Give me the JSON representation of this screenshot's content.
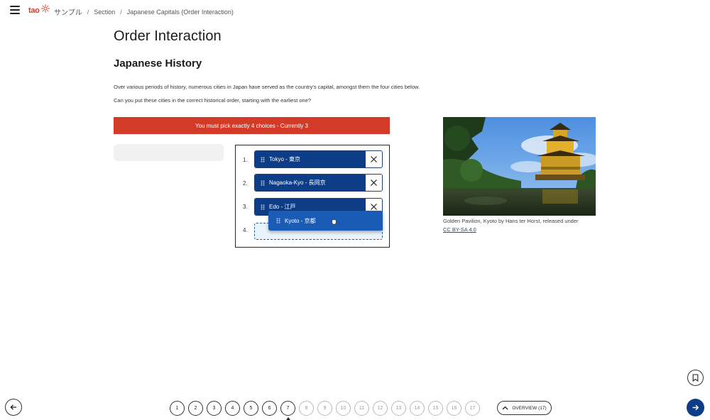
{
  "header": {
    "logo_text": "tao",
    "breadcrumb": [
      "サンプル",
      "Section",
      "Japanese Capitals (Order Interaction)"
    ]
  },
  "content": {
    "title": "Order Interaction",
    "subtitle": "Japanese History",
    "paragraph1": "Over various periods of history, numerous cities in Japan have served as the country's capital, amongst them the four cities below.",
    "paragraph2": "Can you put these cities in the correct historical order, starting with the earliest one?",
    "error_message": "You must pick exactly 4 choices - Currently 3"
  },
  "order": {
    "numbers": [
      "1.",
      "2.",
      "3.",
      "4."
    ],
    "items": [
      {
        "label": "Tokyo - 東京"
      },
      {
        "label": "Nagaoka-Kyo - 長岡京"
      },
      {
        "label": "Edo - 江戸"
      }
    ],
    "dragging_label": "Kyoto - 京都"
  },
  "image": {
    "caption_line1": "Golden Pavilion, Kyoto by Hans ter Horst, released under",
    "caption_link": "CC BY-SA 4.0"
  },
  "navigation": {
    "pages": [
      "1",
      "2",
      "3",
      "4",
      "5",
      "6",
      "7",
      "8",
      "9",
      "10",
      "11",
      "12",
      "13",
      "14",
      "15",
      "16",
      "17"
    ],
    "current_page": 7,
    "overview_label": "OVERVIEW (17)"
  },
  "colors": {
    "accent": "#0c3d86",
    "error": "#d43a28",
    "drag": "#1a5bb5"
  },
  "icons": {
    "menu": "hamburger-icon",
    "remove": "close-icon",
    "bookmark": "bookmark-icon",
    "prev": "arrow-left-icon",
    "next": "arrow-right-icon",
    "overview": "chevron-up-icon"
  }
}
